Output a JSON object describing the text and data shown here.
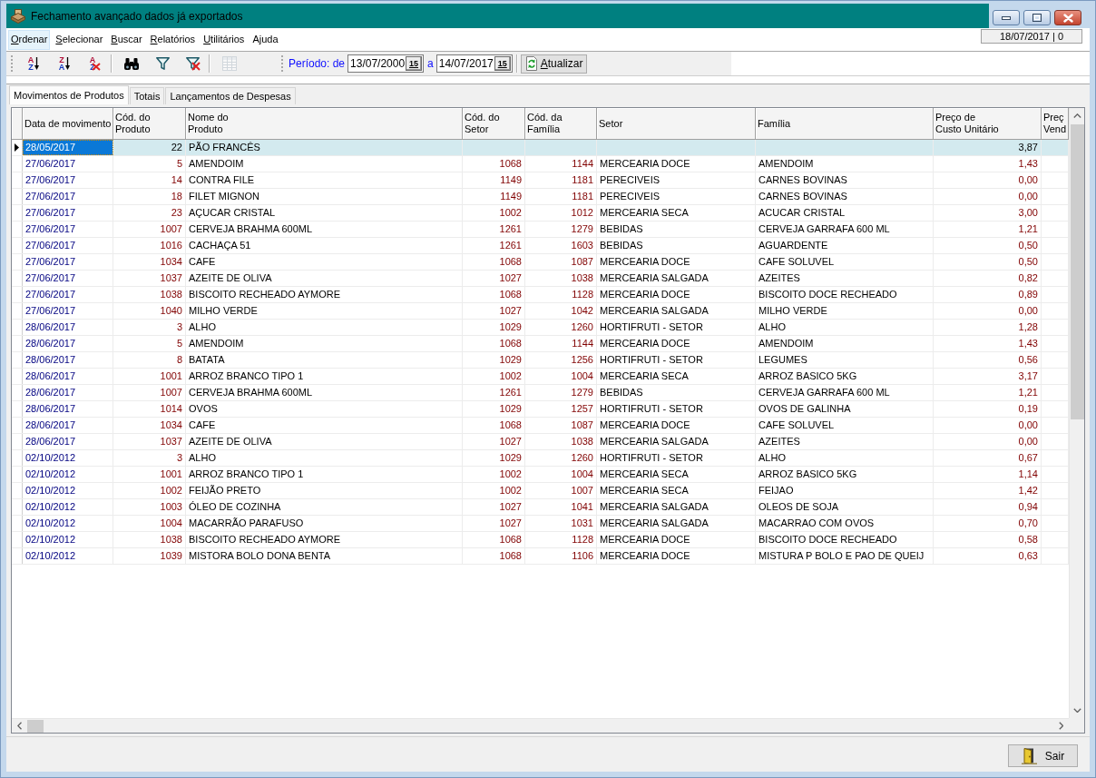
{
  "window": {
    "title": "Fechamento avançado dados já exportados"
  },
  "menu": {
    "items": [
      {
        "label": "Ordenar",
        "accelerator": true,
        "selected": true
      },
      {
        "label": "Selecionar",
        "accelerator": true,
        "selected": false
      },
      {
        "label": "Buscar",
        "accelerator": true,
        "selected": false
      },
      {
        "label": "Relatórios",
        "accelerator": true,
        "selected": false
      },
      {
        "label": "Utilitários",
        "accelerator": true,
        "selected": false
      },
      {
        "label": "Ajuda",
        "accelerator": false,
        "selected": false
      }
    ],
    "status": "18/07/2017 | 0"
  },
  "toolbar": {
    "groups": [
      {
        "buttons": [
          {
            "kind": "sort-ascending",
            "letters": [
              "A",
              "Z"
            ],
            "disabled": false
          },
          {
            "kind": "sort-descending",
            "letters": [
              "Z",
              "A"
            ],
            "disabled": false
          },
          {
            "kind": "sort-clear",
            "letters": [
              "A",
              "Z"
            ],
            "disabled": false
          }
        ]
      },
      {
        "buttons": [
          {
            "kind": "find",
            "disabled": false
          },
          {
            "kind": "filter",
            "disabled": false
          },
          {
            "kind": "filter-clear",
            "disabled": false
          }
        ]
      },
      {
        "buttons": [
          {
            "kind": "columns",
            "disabled": true
          }
        ]
      }
    ]
  },
  "period": {
    "label": "Período: de",
    "from": {
      "value": "13/07/2000",
      "picker": "15"
    },
    "separator": "a",
    "to": {
      "value": "14/07/2017",
      "picker": "15"
    },
    "refresh": {
      "label": "Atualizar",
      "accelerator": true
    }
  },
  "tabs": [
    {
      "label": "Movimentos de Produtos",
      "selected": true
    },
    {
      "label": "Totais",
      "selected": false
    },
    {
      "label": "Lançamentos de Despesas",
      "selected": false
    }
  ],
  "table": {
    "columns": [
      {
        "lines": [
          "Data de movimento"
        ],
        "kind": "date"
      },
      {
        "lines": [
          "Cód. do",
          "Produto"
        ],
        "kind": "code"
      },
      {
        "lines": [
          "Nome do",
          "Produto"
        ],
        "kind": "text"
      },
      {
        "lines": [
          "Cód. do",
          "Setor"
        ],
        "kind": "code"
      },
      {
        "lines": [
          "Cód. da",
          "Família"
        ],
        "kind": "code"
      },
      {
        "lines": [
          "Setor"
        ],
        "kind": "text"
      },
      {
        "lines": [
          "Família"
        ],
        "kind": "text"
      },
      {
        "lines": [
          "Preço de",
          "Custo Unitário"
        ],
        "kind": "price"
      },
      {
        "lines": [
          "Preç",
          "Vend"
        ],
        "kind": "price"
      }
    ],
    "rows": [
      {
        "selected": true,
        "cells": [
          "28/05/2017",
          "22",
          "PÃO FRANCÊS",
          null,
          null,
          null,
          null,
          "3,87"
        ]
      },
      {
        "selected": false,
        "cells": [
          "27/06/2017",
          "5",
          "AMENDOIM",
          "1068",
          "1144",
          "MERCEARIA DOCE",
          "AMENDOIM",
          "1,43"
        ]
      },
      {
        "selected": false,
        "cells": [
          "27/06/2017",
          "14",
          "CONTRA FILE",
          "1149",
          "1181",
          "PERECIVEIS",
          "CARNES BOVINAS",
          "0,00"
        ]
      },
      {
        "selected": false,
        "cells": [
          "27/06/2017",
          "18",
          "FILET MIGNON",
          "1149",
          "1181",
          "PERECIVEIS",
          "CARNES BOVINAS",
          "0,00"
        ]
      },
      {
        "selected": false,
        "cells": [
          "27/06/2017",
          "23",
          "AÇUCAR CRISTAL",
          "1002",
          "1012",
          "MERCEARIA SECA",
          "ACUCAR CRISTAL",
          "3,00"
        ]
      },
      {
        "selected": false,
        "cells": [
          "27/06/2017",
          "1007",
          "CERVEJA BRAHMA 600ML",
          "1261",
          "1279",
          "BEBIDAS",
          "CERVEJA GARRAFA 600 ML",
          "1,21"
        ]
      },
      {
        "selected": false,
        "cells": [
          "27/06/2017",
          "1016",
          "CACHAÇA 51",
          "1261",
          "1603",
          "BEBIDAS",
          "AGUARDENTE",
          "0,50"
        ]
      },
      {
        "selected": false,
        "cells": [
          "27/06/2017",
          "1034",
          "CAFE",
          "1068",
          "1087",
          "MERCEARIA DOCE",
          "CAFE SOLUVEL",
          "0,50"
        ]
      },
      {
        "selected": false,
        "cells": [
          "27/06/2017",
          "1037",
          "AZEITE DE OLIVA",
          "1027",
          "1038",
          "MERCEARIA SALGADA",
          "AZEITES",
          "0,82"
        ]
      },
      {
        "selected": false,
        "cells": [
          "27/06/2017",
          "1038",
          "BISCOITO RECHEADO AYMORE",
          "1068",
          "1128",
          "MERCEARIA DOCE",
          "BISCOITO DOCE RECHEADO",
          "0,89"
        ]
      },
      {
        "selected": false,
        "cells": [
          "27/06/2017",
          "1040",
          "MILHO VERDE",
          "1027",
          "1042",
          "MERCEARIA SALGADA",
          "MILHO VERDE",
          "0,00"
        ]
      },
      {
        "selected": false,
        "cells": [
          "28/06/2017",
          "3",
          "ALHO",
          "1029",
          "1260",
          "HORTIFRUTI - SETOR",
          "ALHO",
          "1,28"
        ]
      },
      {
        "selected": false,
        "cells": [
          "28/06/2017",
          "5",
          "AMENDOIM",
          "1068",
          "1144",
          "MERCEARIA DOCE",
          "AMENDOIM",
          "1,43"
        ]
      },
      {
        "selected": false,
        "cells": [
          "28/06/2017",
          "8",
          "BATATA",
          "1029",
          "1256",
          "HORTIFRUTI - SETOR",
          "LEGUMES",
          "0,56"
        ]
      },
      {
        "selected": false,
        "cells": [
          "28/06/2017",
          "1001",
          "ARROZ BRANCO TIPO 1",
          "1002",
          "1004",
          "MERCEARIA SECA",
          "ARROZ BASICO 5KG",
          "3,17"
        ]
      },
      {
        "selected": false,
        "cells": [
          "28/06/2017",
          "1007",
          "CERVEJA BRAHMA 600ML",
          "1261",
          "1279",
          "BEBIDAS",
          "CERVEJA GARRAFA 600 ML",
          "1,21"
        ]
      },
      {
        "selected": false,
        "cells": [
          "28/06/2017",
          "1014",
          "OVOS",
          "1029",
          "1257",
          "HORTIFRUTI - SETOR",
          "OVOS DE GALINHA",
          "0,19"
        ]
      },
      {
        "selected": false,
        "cells": [
          "28/06/2017",
          "1034",
          "CAFE",
          "1068",
          "1087",
          "MERCEARIA DOCE",
          "CAFE SOLUVEL",
          "0,00"
        ]
      },
      {
        "selected": false,
        "cells": [
          "28/06/2017",
          "1037",
          "AZEITE DE OLIVA",
          "1027",
          "1038",
          "MERCEARIA SALGADA",
          "AZEITES",
          "0,00"
        ]
      },
      {
        "selected": false,
        "cells": [
          "02/10/2012",
          "3",
          "ALHO",
          "1029",
          "1260",
          "HORTIFRUTI - SETOR",
          "ALHO",
          "0,67"
        ]
      },
      {
        "selected": false,
        "cells": [
          "02/10/2012",
          "1001",
          "ARROZ BRANCO TIPO 1",
          "1002",
          "1004",
          "MERCEARIA SECA",
          "ARROZ BASICO 5KG",
          "1,14"
        ]
      },
      {
        "selected": false,
        "cells": [
          "02/10/2012",
          "1002",
          "FEIJÃO PRETO",
          "1002",
          "1007",
          "MERCEARIA SECA",
          "FEIJAO",
          "1,42"
        ]
      },
      {
        "selected": false,
        "cells": [
          "02/10/2012",
          "1003",
          "ÓLEO DE COZINHA",
          "1027",
          "1041",
          "MERCEARIA SALGADA",
          "OLEOS DE SOJA",
          "0,94"
        ]
      },
      {
        "selected": false,
        "cells": [
          "02/10/2012",
          "1004",
          "MACARRÃO PARAFUSO",
          "1027",
          "1031",
          "MERCEARIA SALGADA",
          "MACARRAO COM OVOS",
          "0,70"
        ]
      },
      {
        "selected": false,
        "cells": [
          "02/10/2012",
          "1038",
          "BISCOITO RECHEADO AYMORE",
          "1068",
          "1128",
          "MERCEARIA DOCE",
          "BISCOITO DOCE RECHEADO",
          "0,58"
        ]
      },
      {
        "selected": false,
        "cells": [
          "02/10/2012",
          "1039",
          "MISTORA BOLO DONA BENTA",
          "1068",
          "1106",
          "MERCEARIA DOCE",
          "MISTURA P BOLO E PAO DE QUEIJ",
          "0,63"
        ]
      }
    ]
  },
  "footer": {
    "exit": {
      "label": "Sair",
      "accelerator": false
    }
  }
}
